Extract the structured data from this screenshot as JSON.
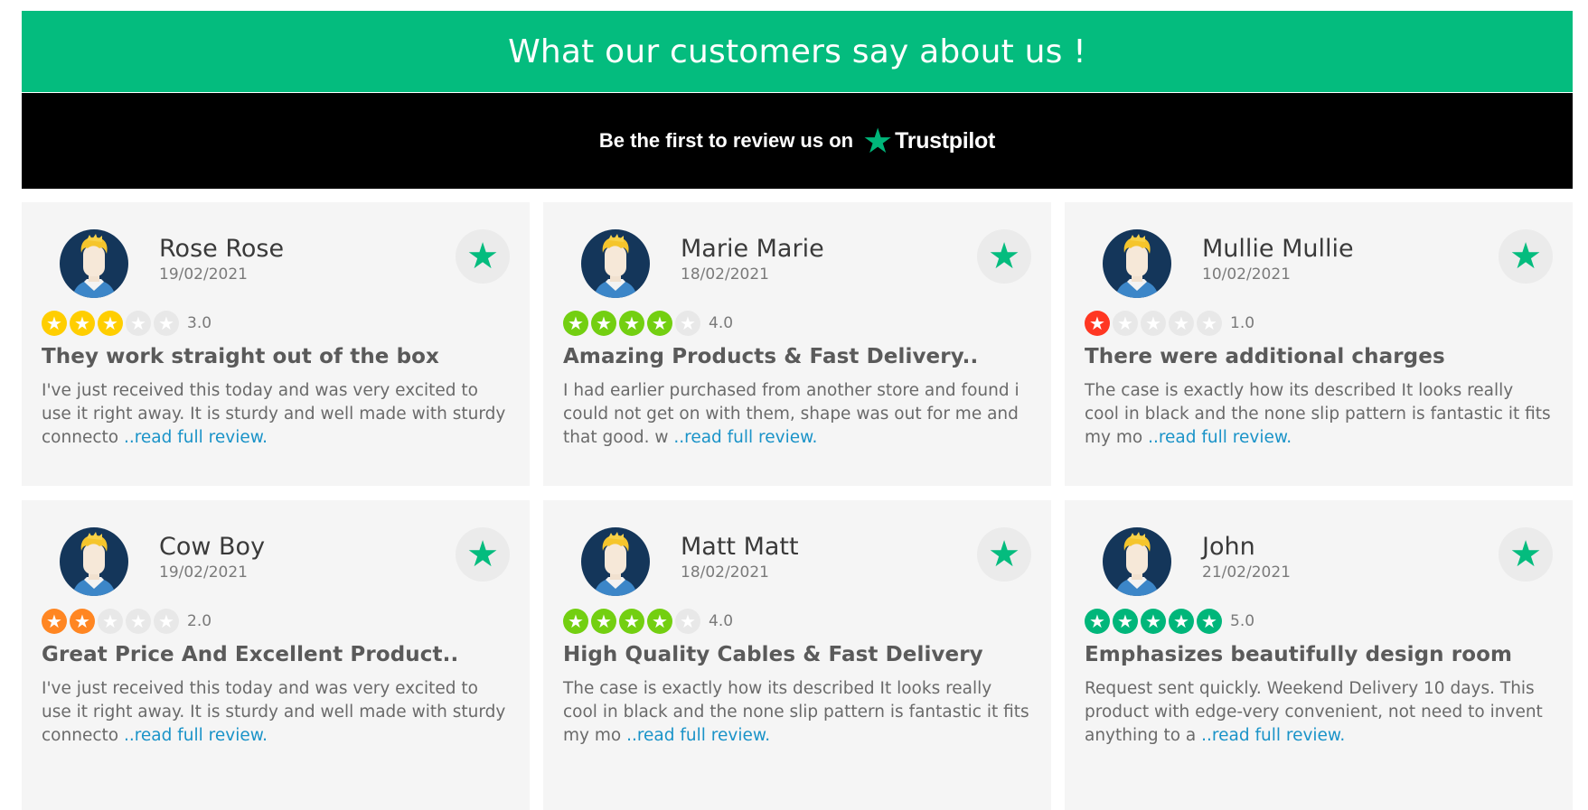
{
  "header": {
    "title": "What our customers say about us !"
  },
  "trustpilot": {
    "prefix": "Be the first to review us on",
    "brand": "Trustpilot",
    "icon": "trustpilot-star-icon"
  },
  "colors": {
    "accent_green": "#04bc7e",
    "link_blue": "#1a93c8",
    "star_1": "#ff3722",
    "star_2": "#ff8622",
    "star_3": "#ffce00",
    "star_4": "#73cf11",
    "star_5": "#00b67a"
  },
  "reviews": [
    {
      "name": "Rose Rose",
      "date": "19/02/2021",
      "rating": 3,
      "score": "3.0",
      "title": "They work straight out of the box",
      "body": "I've just received this today and was very excited to use it right away. It is sturdy and well made with sturdy connecto",
      "more": "..read full review."
    },
    {
      "name": "Marie Marie",
      "date": "18/02/2021",
      "rating": 4,
      "score": "4.0",
      "title": "Amazing Products & Fast Delivery..",
      "body": "I had earlier purchased from another store and found i could not get on with them, shape was out for me and that good. w",
      "more": "..read full review."
    },
    {
      "name": "Mullie Mullie",
      "date": "10/02/2021",
      "rating": 1,
      "score": "1.0",
      "title": "There were additional charges",
      "body": "The case is exactly how its described It looks really cool in black and the none slip pattern is fantastic it fits my mo",
      "more": "..read full review."
    },
    {
      "name": "Cow Boy",
      "date": "19/02/2021",
      "rating": 2,
      "score": "2.0",
      "title": "Great Price And Excellent Product..",
      "body": "I've just received this today and was very excited to use it right away. It is sturdy and well made with sturdy connecto",
      "more": "..read full review."
    },
    {
      "name": "Matt Matt",
      "date": "18/02/2021",
      "rating": 4,
      "score": "4.0",
      "title": "High Quality Cables & Fast Delivery",
      "body": "The case is exactly how its described It looks really cool in black and the none slip pattern is fantastic it fits my mo",
      "more": "..read full review."
    },
    {
      "name": "John",
      "date": "21/02/2021",
      "rating": 5,
      "score": "5.0",
      "title": "Emphasizes beautifully design room",
      "body": "Request sent quickly. Weekend Delivery 10 days. This product with edge-very convenient, not need to invent anything to a",
      "more": "..read full review."
    }
  ]
}
